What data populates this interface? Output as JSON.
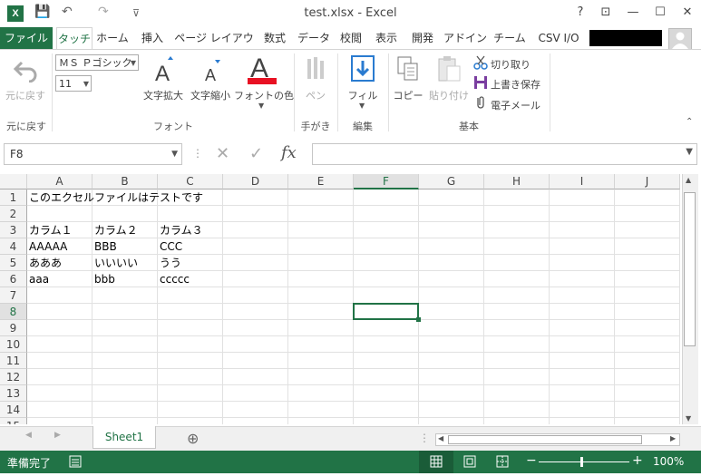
{
  "window": {
    "title": "test.xlsx - Excel",
    "help": "?",
    "ribbon_display": "⊡",
    "minimize": "—",
    "maximize": "☐",
    "close": "✕"
  },
  "qat": {
    "save": "💾",
    "undo": "↶",
    "redo": "↷",
    "customize": "⊽"
  },
  "tabs": [
    {
      "label": "ファイル"
    },
    {
      "label": "タッチ"
    },
    {
      "label": "ホーム"
    },
    {
      "label": "挿入"
    },
    {
      "label": "ページ レイアウト"
    },
    {
      "label": "数式"
    },
    {
      "label": "データ"
    },
    {
      "label": "校閲"
    },
    {
      "label": "表示"
    },
    {
      "label": "開発"
    },
    {
      "label": "アドイン"
    },
    {
      "label": "チーム"
    },
    {
      "label": "CSV I/O"
    }
  ],
  "ribbon": {
    "undo_group": {
      "button": "元に戻す",
      "group_label": "元に戻す"
    },
    "font_group": {
      "font_name": "ＭＳ Ｐゴシック",
      "font_size": "11",
      "grow": "文字拡大",
      "shrink": "文字縮小",
      "color": "フォントの色",
      "group_label": "フォント"
    },
    "ink_group": {
      "pen": "ペン",
      "group_label": "手がき"
    },
    "edit_group": {
      "fill": "フィル",
      "group_label": "編集"
    },
    "basic_group": {
      "copy": "コピー",
      "paste": "貼り付け",
      "cut": "切り取り",
      "overwrite_save": "上書き保存",
      "email": "電子メール",
      "group_label": "基本"
    }
  },
  "formula_bar": {
    "name_box": "F8",
    "cancel": "✕",
    "enter": "✓",
    "fx": "fx",
    "value": ""
  },
  "columns": [
    "A",
    "B",
    "C",
    "D",
    "E",
    "F",
    "G",
    "H",
    "I",
    "J"
  ],
  "selected_column": "F",
  "rows": [
    "1",
    "2",
    "3",
    "4",
    "5",
    "6",
    "7",
    "8",
    "9",
    "10",
    "11",
    "12",
    "13",
    "14",
    "15"
  ],
  "selected_row": "8",
  "cells": {
    "A1": "このエクセルファイルはテストです",
    "A3": "カラム１",
    "B3": "カラム２",
    "C3": "カラム３",
    "A4": "AAAAA",
    "B4": "BBB",
    "C4": "CCC",
    "A5": "あああ",
    "B5": "いいいい",
    "C5": "うう",
    "A6": "aaa",
    "B6": "bbb",
    "C6": "ccccc"
  },
  "sheets": [
    {
      "label": "Sheet1"
    }
  ],
  "add_sheet": "⊕",
  "status": {
    "ready": "準備完了",
    "zoom": "100%",
    "zoom_minus": "−",
    "zoom_plus": "+"
  },
  "colors": {
    "excel_green": "#217346",
    "font_color_bar": "#e81123"
  }
}
